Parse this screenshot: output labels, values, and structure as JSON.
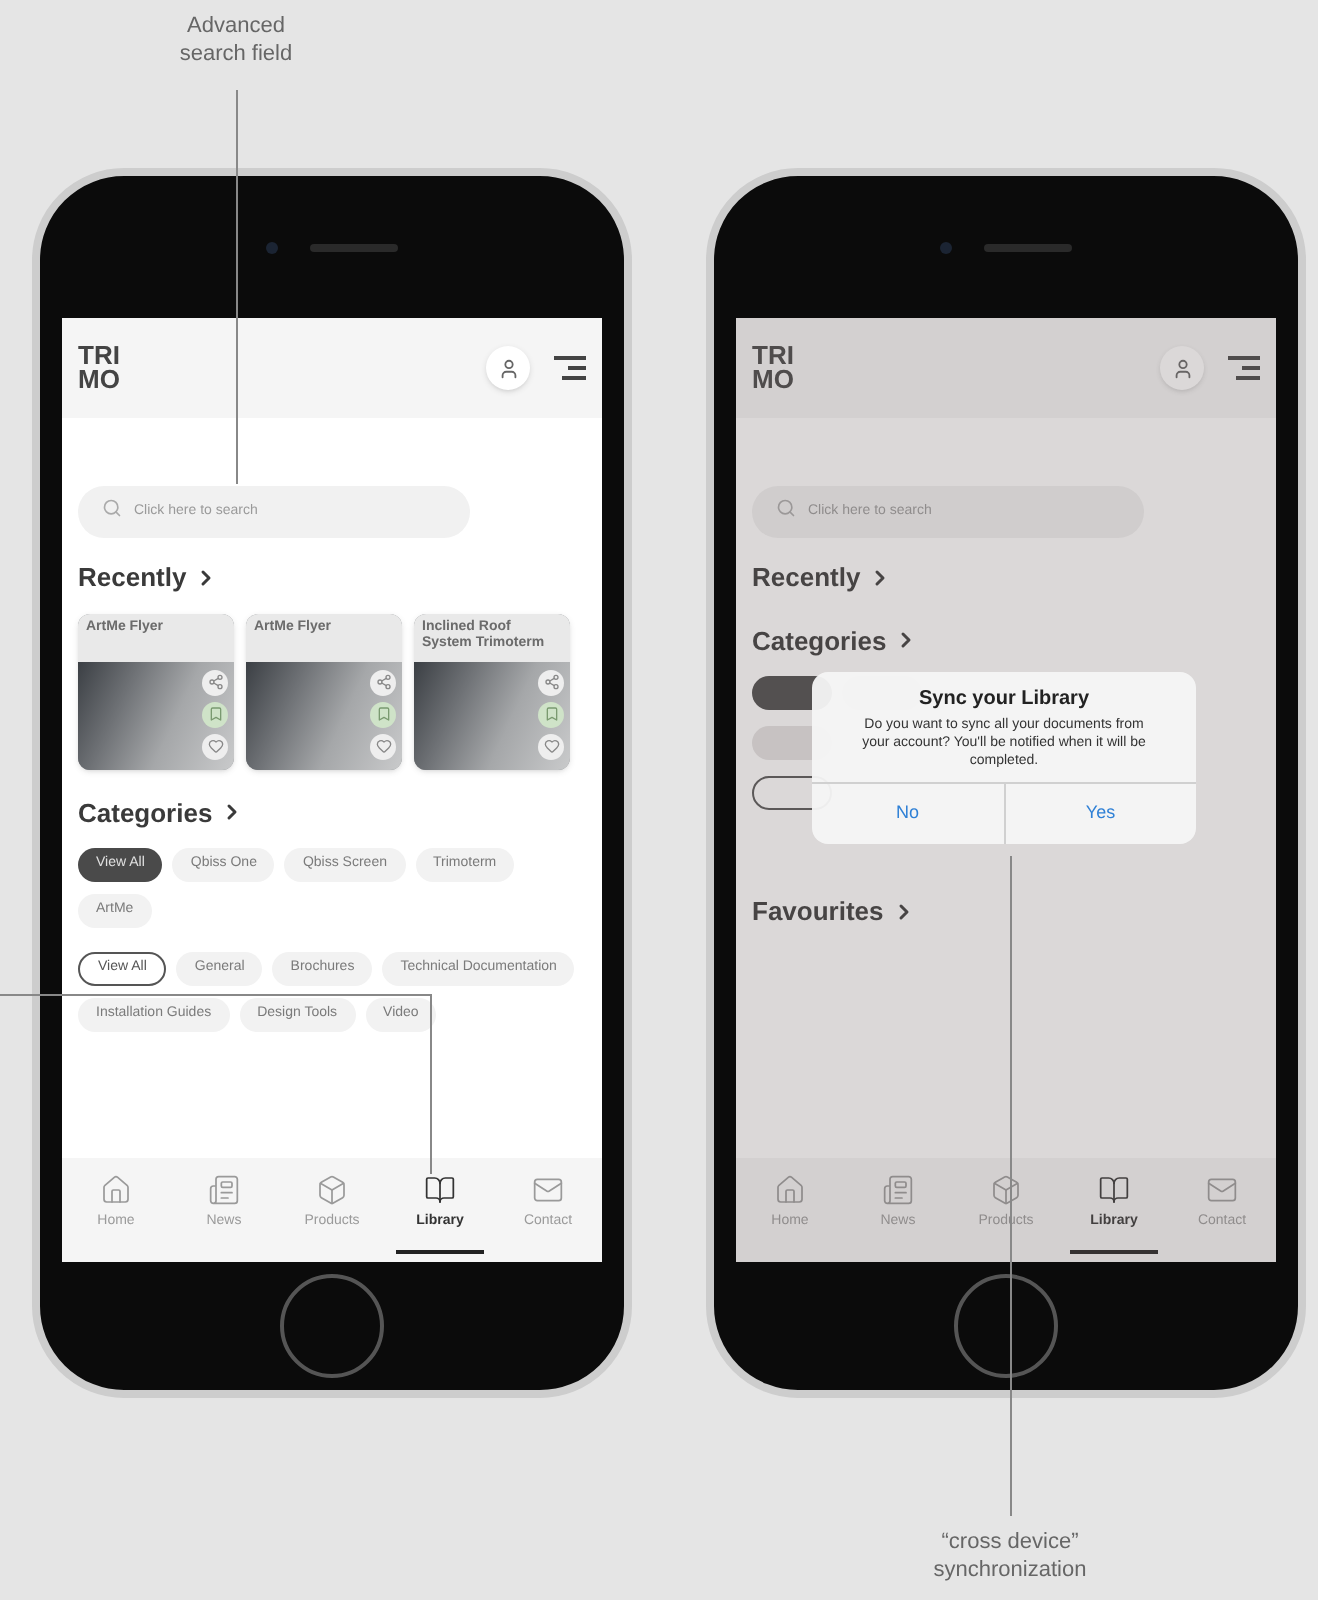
{
  "annotations": [
    {
      "kind": "top",
      "text": "Advanced search field"
    },
    {
      "kind": "bottom",
      "text": "“cross device” synchronization"
    }
  ],
  "phones": [
    {
      "dimmed": false,
      "logo": [
        "TRI",
        "MO"
      ],
      "search": {
        "placeholder": "Click here to search"
      },
      "sections": [
        {
          "kind": "cards",
          "title": "Recently",
          "cards": [
            {
              "title": "ArtMe Flyer"
            },
            {
              "title": "ArtMe Flyer"
            },
            {
              "title": "Inclined Roof System Trimoterm"
            }
          ]
        },
        {
          "kind": "chips",
          "title": "Categories",
          "groups": [
            {
              "kind": "filled",
              "chips": [
                {
                  "label": "View All",
                  "selected": true
                },
                {
                  "label": "Qbiss One",
                  "selected": false
                },
                {
                  "label": "Qbiss Screen",
                  "selected": false
                },
                {
                  "label": "Trimoterm",
                  "selected": false
                },
                {
                  "label": "ArtMe",
                  "selected": false
                }
              ]
            },
            {
              "kind": "outline",
              "chips": [
                {
                  "label": "View All",
                  "selected": true
                },
                {
                  "label": "General",
                  "selected": false
                },
                {
                  "label": "Brochures",
                  "selected": false
                },
                {
                  "label": "Technical Documentation",
                  "selected": false
                },
                {
                  "label": "Installation Guides",
                  "selected": false
                },
                {
                  "label": "Design Tools",
                  "selected": false
                },
                {
                  "label": "Video",
                  "selected": false
                }
              ]
            }
          ]
        }
      ],
      "nav": [
        {
          "kind": "home",
          "label": "Home",
          "selected": false
        },
        {
          "kind": "news",
          "label": "News",
          "selected": false
        },
        {
          "kind": "products",
          "label": "Products",
          "selected": false
        },
        {
          "kind": "library",
          "label": "Library",
          "selected": true
        },
        {
          "kind": "contact",
          "label": "Contact",
          "selected": false
        }
      ]
    },
    {
      "dimmed": true,
      "logo": [
        "TRI",
        "MO"
      ],
      "search": {
        "placeholder": "Click here to search"
      },
      "sections": [
        {
          "kind": "heading",
          "title": "Recently"
        },
        {
          "kind": "hidden_chips",
          "title": "Categories"
        },
        {
          "kind": "heading",
          "title": "Favourites"
        }
      ],
      "nav": [
        {
          "kind": "home",
          "label": "Home",
          "selected": false
        },
        {
          "kind": "news",
          "label": "News",
          "selected": false
        },
        {
          "kind": "products",
          "label": "Products",
          "selected": false
        },
        {
          "kind": "library",
          "label": "Library",
          "selected": true
        },
        {
          "kind": "contact",
          "label": "Contact",
          "selected": false
        }
      ],
      "dialog": {
        "title": "Sync your Library",
        "message": "Do you want to sync all your documents from your account? You'll be notified when it will be completed.",
        "buttons": [
          "No",
          "Yes"
        ]
      }
    }
  ]
}
